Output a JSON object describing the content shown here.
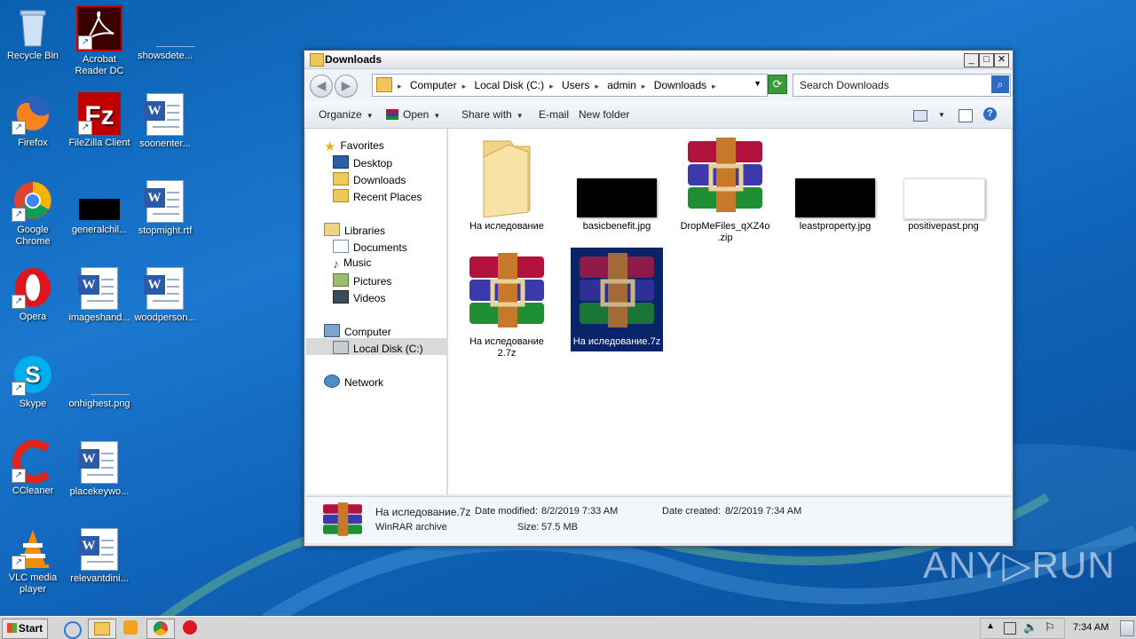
{
  "desktop": {
    "icons": [
      {
        "label": "Recycle Bin"
      },
      {
        "label": "Acrobat Reader DC"
      },
      {
        "label": "showsdete..."
      },
      {
        "label": "Firefox"
      },
      {
        "label": "FileZilla Client"
      },
      {
        "label": "soonenter..."
      },
      {
        "label": "Google Chrome"
      },
      {
        "label": "generalchil..."
      },
      {
        "label": "stopmight.rtf"
      },
      {
        "label": "Opera"
      },
      {
        "label": "imageshand..."
      },
      {
        "label": "woodperson..."
      },
      {
        "label": "Skype"
      },
      {
        "label": "onhighest.png"
      },
      {
        "label": "CCleaner"
      },
      {
        "label": "placekeywo..."
      },
      {
        "label": "VLC media player"
      },
      {
        "label": "relevantdini..."
      }
    ]
  },
  "window": {
    "title": "Downloads",
    "min_btn": "_",
    "max_btn": "□",
    "close_btn": "✕",
    "address": {
      "crumbs": [
        "Computer",
        "Local Disk (C:)",
        "Users",
        "admin",
        "Downloads"
      ],
      "search_placeholder": "Search Downloads"
    },
    "toolbar": {
      "organize": "Organize",
      "open": "Open",
      "share_with": "Share with",
      "email": "E-mail",
      "new_folder": "New folder"
    },
    "nav": {
      "favorites": "Favorites",
      "desktop": "Desktop",
      "downloads": "Downloads",
      "recent": "Recent Places",
      "libraries": "Libraries",
      "documents": "Documents",
      "music": "Music",
      "pictures": "Pictures",
      "videos": "Videos",
      "computer": "Computer",
      "local_disk": "Local Disk (C:)",
      "network": "Network"
    },
    "files": [
      {
        "name": "На иследование",
        "type": "folder"
      },
      {
        "name": "basicbenefit.jpg",
        "type": "black-image"
      },
      {
        "name": "DropMeFiles_qXZ4o .zip",
        "type": "rar"
      },
      {
        "name": "leastproperty.jpg",
        "type": "black-image"
      },
      {
        "name": "positivepast.png",
        "type": "white-image"
      },
      {
        "name": "На иследование 2.7z",
        "type": "rar"
      },
      {
        "name": "На иследование.7z",
        "type": "rar",
        "selected": true
      }
    ],
    "status": {
      "name": "На иследование.7z",
      "type": "WinRAR archive",
      "date_modified_label": "Date modified:",
      "date_modified": "8/2/2019 7:33 AM",
      "date_created_label": "Date created:",
      "date_created": "8/2/2019 7:34 AM",
      "size_label": "Size:",
      "size": "57.5 MB"
    }
  },
  "taskbar": {
    "start": "Start",
    "clock": "7:34 AM"
  },
  "watermark": "ANY▷RUN"
}
